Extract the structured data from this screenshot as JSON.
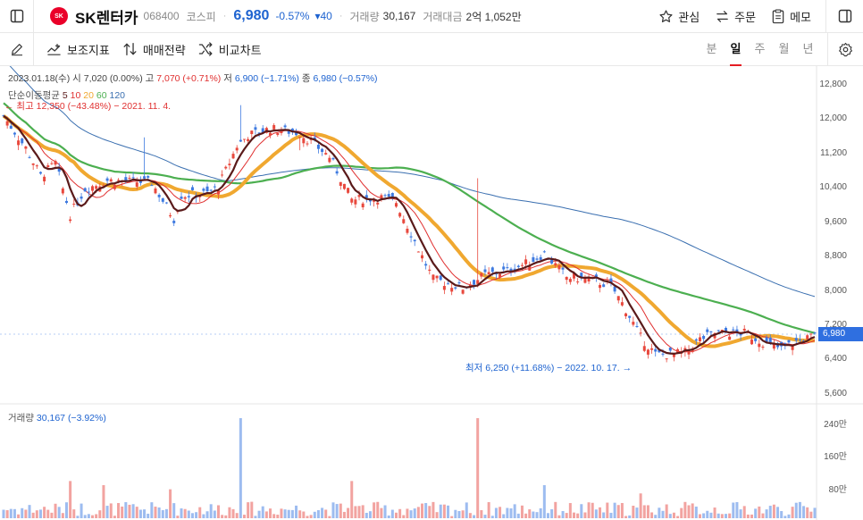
{
  "header": {
    "logo_text": "SK",
    "stock_name": "SK렌터카",
    "stock_code": "068400",
    "market": "코스피",
    "price": "6,980",
    "change_pct": "-0.57%",
    "change_amt": "▾40",
    "volume_label": "거래량",
    "volume_value": "30,167",
    "amount_label": "거래대금",
    "amount_value": "2억 1,052만",
    "watch_label": "관심",
    "order_label": "주문",
    "memo_label": "메모",
    "accent_down": "#1e63d0",
    "brand": "#ea0029"
  },
  "toolbar": {
    "indicators_label": "보조지표",
    "strategy_label": "매매전략",
    "compare_label": "비교차트",
    "periods": [
      "분",
      "일",
      "주",
      "월",
      "년"
    ],
    "active_period": "일"
  },
  "chart": {
    "date_label": "2023.01.18(수)",
    "open_label": "시",
    "open_value": "7,020 (0.00%)",
    "high_label": "고",
    "high_value": "7,070 (+0.71%)",
    "low_label": "저",
    "low_value": "6,900 (−1.71%)",
    "close_label": "종",
    "close_value": "6,980 (−0.57%)",
    "ma_title": "단순이동평균",
    "ma_periods": [
      "5",
      "10",
      "20",
      "60",
      "120"
    ],
    "ma_colors": [
      "#5a1a1a",
      "#e03030",
      "#f0a830",
      "#4caf50",
      "#3a6fb0"
    ],
    "high_note": "← 최고 12,350 (−43.48%) − 2021. 11. 4.",
    "low_note": "최저 6,250 (+11.68%) − 2022. 10. 17. →",
    "price_ticks": [
      "12,800",
      "12,000",
      "11,200",
      "10,400",
      "9,600",
      "8,800",
      "8,000",
      "7,200",
      "6,400",
      "5,600"
    ],
    "current_price_tag": "6,980",
    "volume_label": "거래량",
    "volume_value": "30,167 (−3.92%)",
    "volume_ticks": [
      "240만",
      "160만",
      "80만"
    ]
  }
}
